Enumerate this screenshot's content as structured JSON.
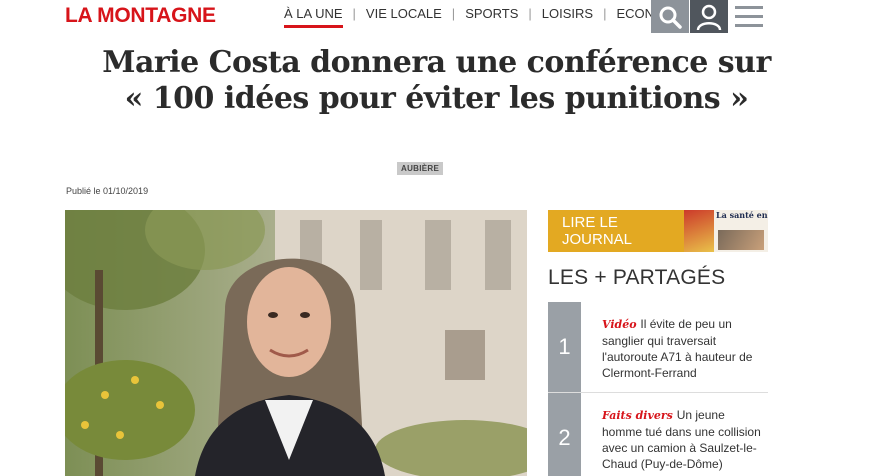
{
  "header": {
    "logo": "LA MONTAGNE",
    "nav": [
      {
        "label": "À LA UNE",
        "active": true
      },
      {
        "label": "VIE LOCALE",
        "active": false
      },
      {
        "label": "SPORTS",
        "active": false
      },
      {
        "label": "LOISIRS",
        "active": false
      },
      {
        "label": "ECONOMIE",
        "active": false
      }
    ],
    "icons": {
      "search": "search-icon",
      "user": "user-icon",
      "menu": "menu-icon"
    }
  },
  "article": {
    "title": "Marie Costa donnera une conférence sur « 100 idées pour éviter les punitions »",
    "tag": "AUBIÈRE",
    "published": "Publié le 01/10/2019",
    "photo": "portrait-photo"
  },
  "sidebar": {
    "journal_label": "LIRE LE JOURNAL",
    "journal_cover_headline": "La santé en re passée au scan",
    "shared_title": "LES + PARTAGÉS",
    "shared_items": [
      {
        "number": "1",
        "category": "Vidéo",
        "text": "Il évite de peu un sanglier qui traversait l'autoroute A71 à hauteur de Clermont-Ferrand"
      },
      {
        "number": "2",
        "category": "Faits divers",
        "text": "Un jeune homme tué dans une collision avec un camion à Saulzet-le-Chaud (Puy-de-Dôme)"
      }
    ]
  },
  "colors": {
    "brand": "#d7141a",
    "journal": "#e3a922",
    "number_bg": "#9aa0a6"
  }
}
